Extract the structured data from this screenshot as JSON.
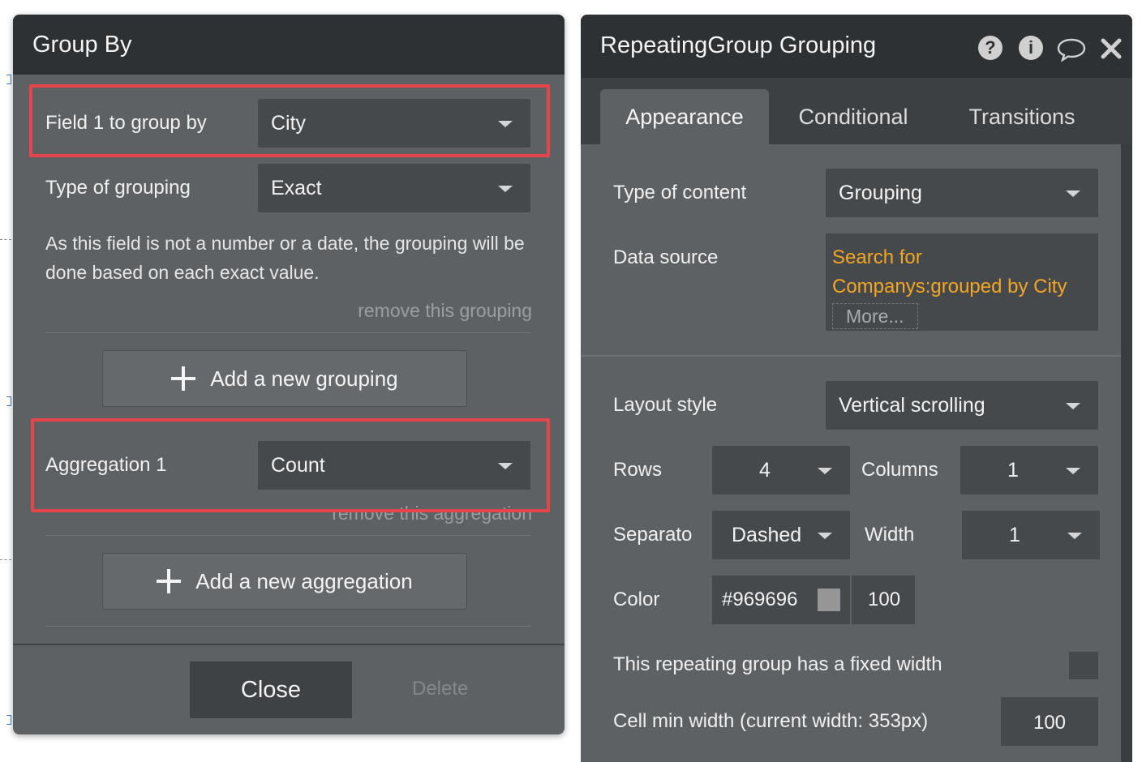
{
  "group_by_dialog": {
    "title": "Group By",
    "field1": {
      "label": "Field 1 to group by",
      "value": "City"
    },
    "grouping_type": {
      "label": "Type of grouping",
      "value": "Exact"
    },
    "hint": "As this field is not a number or a date, the grouping will be done based on each exact value.",
    "remove_grouping": "remove this grouping",
    "add_grouping": "Add a new grouping",
    "aggregation1": {
      "label": "Aggregation 1",
      "value": "Count"
    },
    "remove_aggregation": "remove this aggregation",
    "add_aggregation": "Add a new aggregation",
    "close": "Close",
    "delete": "Delete",
    "highlight_color": "#e5454b"
  },
  "property_editor": {
    "title": "RepeatingGroup Grouping",
    "icons": [
      "help-icon",
      "info-icon",
      "comment-icon",
      "close-icon"
    ],
    "tabs": [
      "Appearance",
      "Conditional",
      "Transitions"
    ],
    "active_tab": "Appearance",
    "type_of_content": {
      "label": "Type of content",
      "value": "Grouping"
    },
    "data_source": {
      "label": "Data source",
      "line1": "Search for",
      "line2": "Companys:grouped by City",
      "more": "More..."
    },
    "layout_style": {
      "label": "Layout style",
      "value": "Vertical scrolling"
    },
    "rows": {
      "label": "Rows",
      "value": "4"
    },
    "columns": {
      "label": "Columns",
      "value": "1"
    },
    "separator": {
      "label": "Separato",
      "value": "Dashed"
    },
    "width": {
      "label": "Width",
      "value": "1"
    },
    "color": {
      "label": "Color",
      "hex": "#969696",
      "opacity": "100"
    },
    "fixed_width": {
      "label": "This repeating group has a fixed width"
    },
    "cell_min_width": {
      "label": "Cell min width (current width: 353px)",
      "value": "100"
    },
    "data_source_color": "#f4a623"
  }
}
